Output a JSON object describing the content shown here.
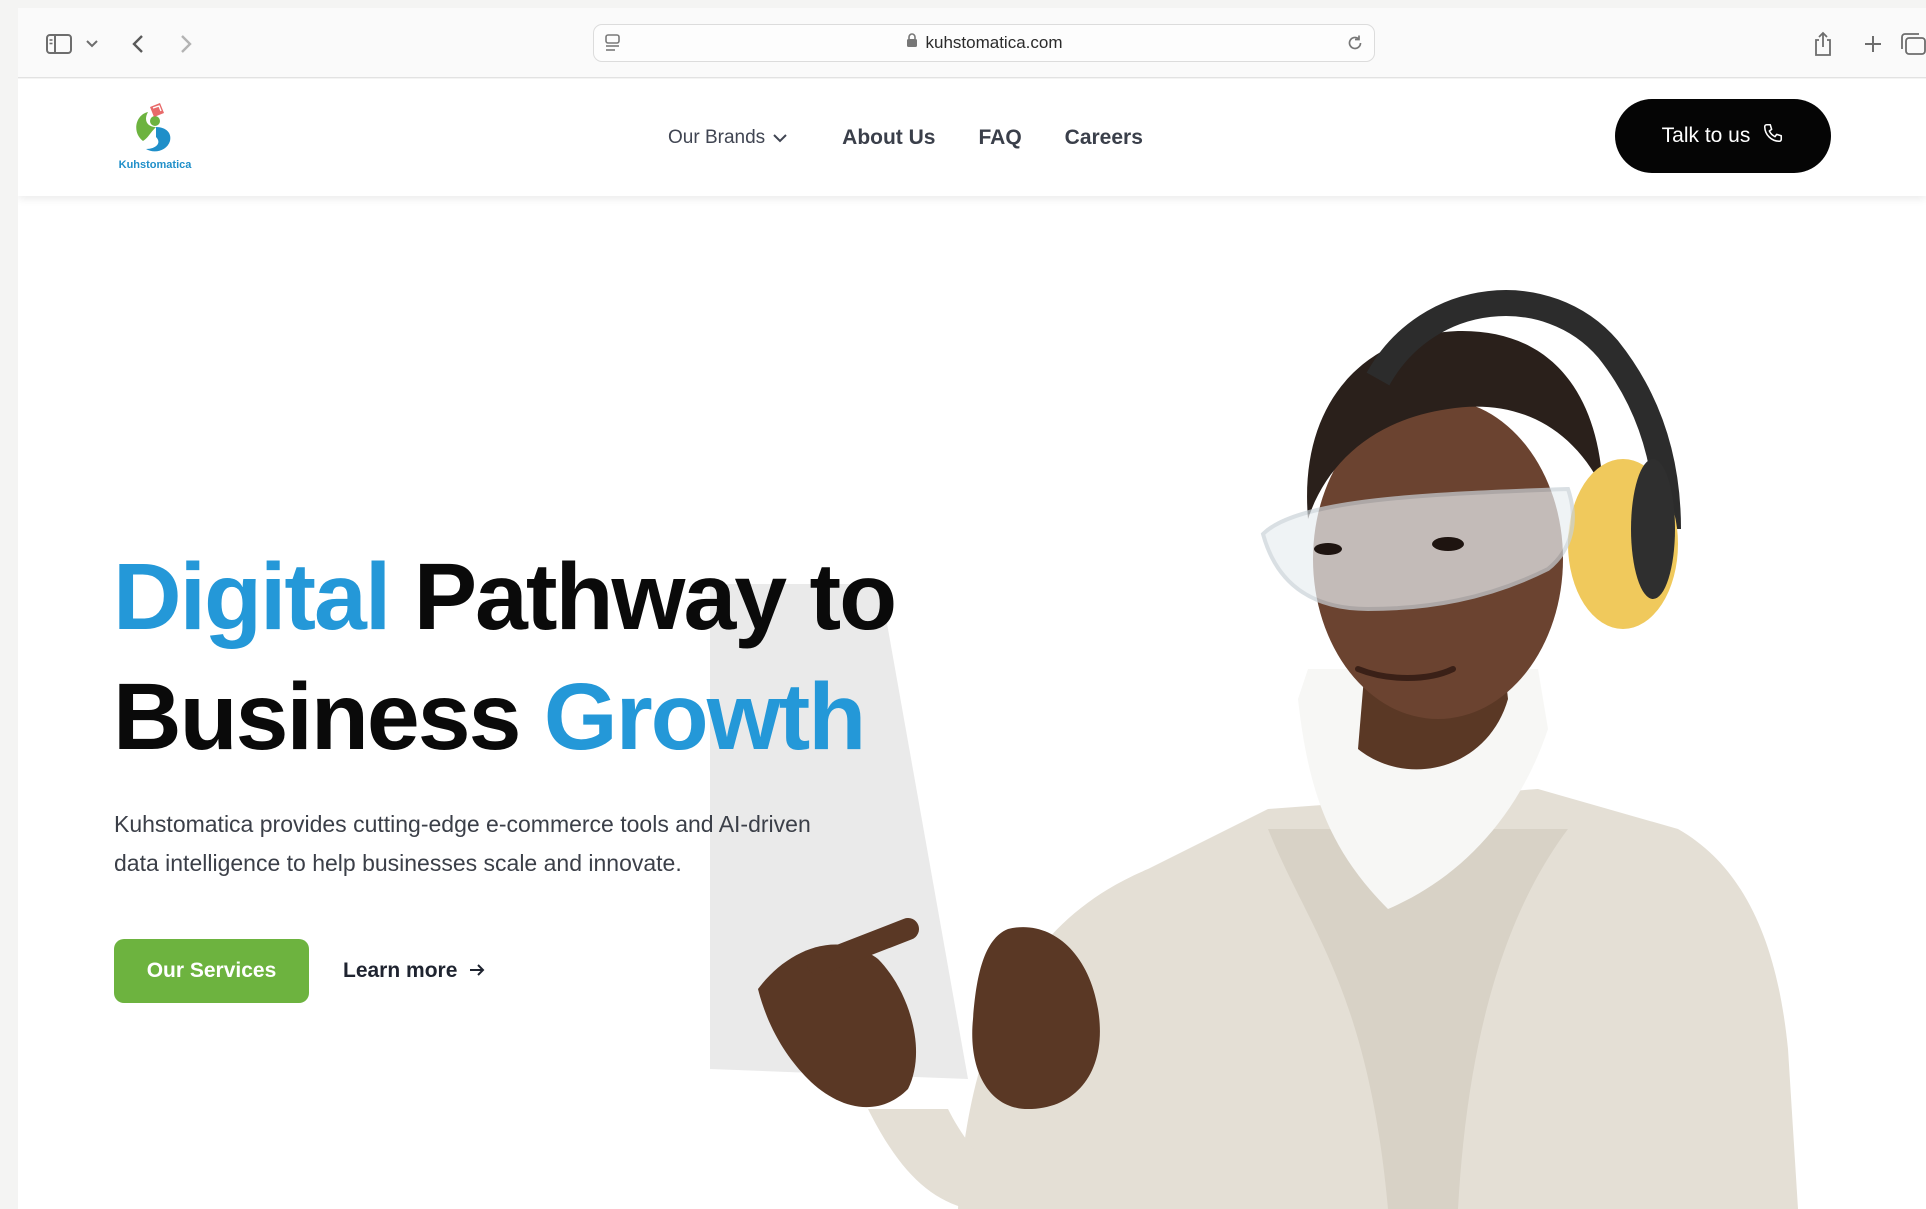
{
  "browser": {
    "url": "kuhstomatica.com"
  },
  "nav": {
    "logo_text": "Kuhstomatica",
    "links": [
      {
        "label": "Our Brands"
      },
      {
        "label": "About Us"
      },
      {
        "label": "FAQ"
      },
      {
        "label": "Careers"
      }
    ],
    "cta_label": "Talk to us"
  },
  "hero": {
    "title_line1_accent": "Digital",
    "title_line1_rest": " Pathway to",
    "title_line2_rest": "Business ",
    "title_line2_accent": "Growth",
    "description_line1": "Kuhstomatica provides cutting-edge e-commerce tools and AI-driven",
    "description_line2": "data intelligence to help businesses scale and innovate.",
    "primary_button": "Our Services",
    "secondary_link": "Learn more"
  },
  "colors": {
    "accent_blue": "#2498d8",
    "services_green": "#6db33f",
    "cta_black": "#050505"
  },
  "icons": [
    "sidebar-icon",
    "chevron-down-icon",
    "back-icon",
    "forward-icon",
    "reader-icon",
    "lock-icon",
    "reload-icon",
    "share-icon",
    "new-tab-icon",
    "tabs-overview-icon",
    "phone-icon",
    "arrow-right-icon"
  ]
}
